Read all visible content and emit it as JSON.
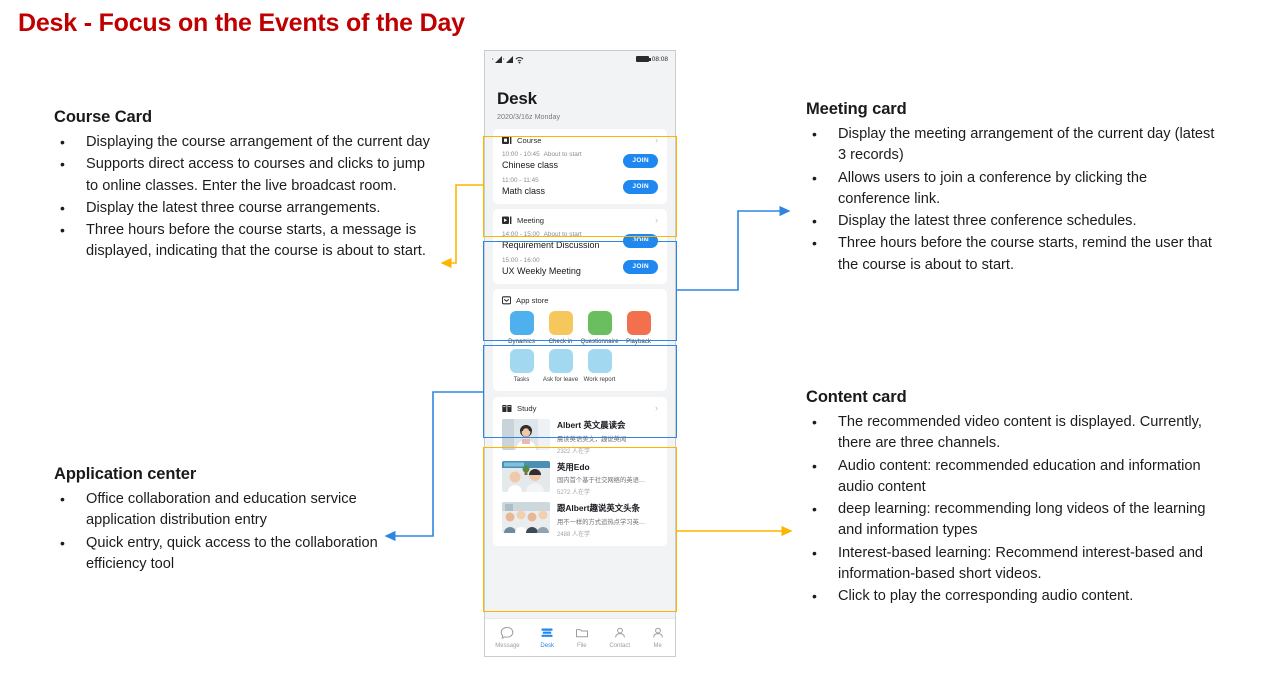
{
  "slide": {
    "title": "Desk - Focus on the Events of the Day",
    "title_color": "#C00000"
  },
  "colors": {
    "accent_blue": "#1E88F0",
    "highlight_orange": "#FFB400",
    "highlight_blue": "#2E86E0",
    "title_red": "#C00000"
  },
  "notes": {
    "course_card": {
      "heading": "Course Card",
      "bullets": [
        "Displaying the course arrangement of the current day",
        "Supports direct access to courses and clicks to jump to online classes. Enter the live broadcast room.",
        "Display the latest three course arrangements.",
        "Three hours before the course starts, a message is displayed, indicating that the course is about to start."
      ]
    },
    "application_center": {
      "heading": "Application center",
      "bullets": [
        "Office collaboration and education service application distribution entry",
        "Quick entry, quick access to the collaboration efficiency tool"
      ]
    },
    "meeting_card": {
      "heading": "Meeting card",
      "bullets": [
        "Display the meeting arrangement of the current day (latest 3 records)",
        "Allows users to join a conference by clicking the conference link.",
        "Display the latest three conference schedules.",
        "Three hours before the course starts, remind the user that the course is about to start."
      ]
    },
    "content_card": {
      "heading": "Content card",
      "bullets": [
        "The recommended video content is displayed. Currently, there are three channels.",
        "Audio content: recommended education and information audio content",
        "deep learning: recommending long videos of the learning and information types",
        "Interest-based learning: Recommend interest-based and information-based short videos.",
        "Click to play the corresponding audio content."
      ]
    }
  },
  "phone": {
    "status_bar": {
      "time": "08:08"
    },
    "header": {
      "title": "Desk",
      "date": "2020/3/16z Monday"
    },
    "course_card": {
      "label": "Course",
      "icon": "course-icon",
      "chevron": "›",
      "items": [
        {
          "time": "10:00 - 10:45",
          "status": "About to start",
          "title": "Chinese class",
          "action": "JOIN"
        },
        {
          "time": "11:00 - 11:45",
          "status": "",
          "title": "Math class",
          "action": "JOIN"
        }
      ]
    },
    "meeting_card": {
      "label": "Meeting",
      "icon": "meeting-icon",
      "chevron": "›",
      "items": [
        {
          "time": "14:00 - 15:00",
          "status": "About to start",
          "title": "Requirement Discussion",
          "action": "JOIN"
        },
        {
          "time": "15:00 - 16:00",
          "status": "",
          "title": "UX Weekly Meeting",
          "action": "JOIN"
        }
      ]
    },
    "app_store_card": {
      "label": "App store",
      "icon": "appstore-icon",
      "apps": [
        {
          "label": "Dynamics",
          "color": "#4FB0EE"
        },
        {
          "label": "Check in",
          "color": "#F6C75B"
        },
        {
          "label": "Questionnaire",
          "color": "#6BBE5F"
        },
        {
          "label": "Playback",
          "color": "#F2704E"
        },
        {
          "label": "Tasks",
          "color": "#A3D9F0"
        },
        {
          "label": "Ask for leave",
          "color": "#A3D9F0"
        },
        {
          "label": "Work report",
          "color": "#A3D9F0"
        }
      ]
    },
    "study_card": {
      "label": "Study",
      "icon": "study-icon",
      "chevron": "›",
      "items": [
        {
          "title": "Albert 英文晨读会",
          "subtitle": "晨读英语美文，趣说英闻",
          "count": "2322 人在学"
        },
        {
          "title": "英用Edo",
          "subtitle": "国内首个基于社交网络的英语…",
          "count": "5272 人在学"
        },
        {
          "title": "跟Albert趣说英文头条",
          "subtitle": "用不一样的方式追热点学习英…",
          "count": "2488 人在学"
        }
      ]
    },
    "tabbar": {
      "tabs": [
        {
          "label": "Message",
          "icon": "chat-bubble-icon",
          "active": false
        },
        {
          "label": "Desk",
          "icon": "desk-icon",
          "active": true
        },
        {
          "label": "File",
          "icon": "folder-icon",
          "active": false
        },
        {
          "label": "Contact",
          "icon": "contact-icon",
          "active": false
        },
        {
          "label": "Me",
          "icon": "person-icon",
          "active": false
        }
      ]
    }
  }
}
